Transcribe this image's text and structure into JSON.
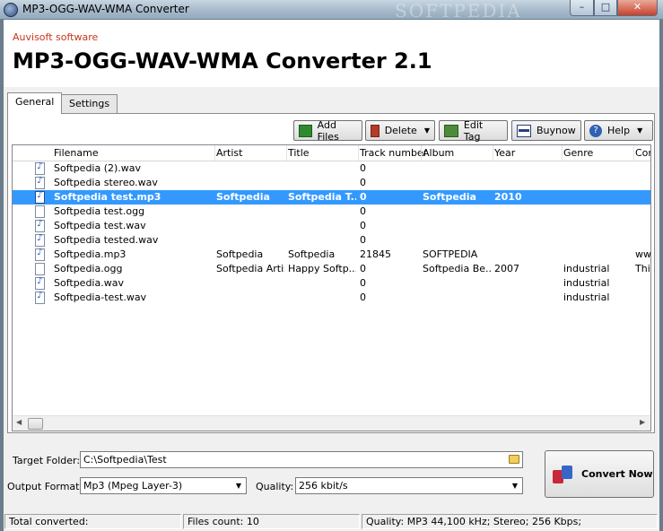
{
  "window": {
    "title": "MP3-OGG-WAV-WMA Converter",
    "watermark": "SOFTPEDIA",
    "minimize_glyph": "–",
    "maximize_glyph": "□",
    "close_glyph": "✕"
  },
  "header": {
    "vendor": "Auvisoft software",
    "product": "MP3-OGG-WAV-WMA Converter 2.1"
  },
  "tabs": [
    {
      "label": "General",
      "active": true
    },
    {
      "label": "Settings",
      "active": false
    }
  ],
  "toolbar": {
    "add_files": "Add Files",
    "delete": "Delete",
    "edit_tag": "Edit Tag",
    "buynow": "Buynow",
    "help": "Help",
    "dropdown_glyph": "▼",
    "help_glyph": "?"
  },
  "columns": [
    "Filename",
    "Artist",
    "Title",
    "Track number",
    "Album",
    "Year",
    "Genre",
    "Com"
  ],
  "rows": [
    {
      "filename": "Softpedia (2).wav",
      "artist": "",
      "title": "",
      "track": "0",
      "album": "",
      "year": "",
      "genre": "",
      "comment": "",
      "icon": "audio-file-icon",
      "selected": false
    },
    {
      "filename": "Softpedia stereo.wav",
      "artist": "",
      "title": "",
      "track": "0",
      "album": "",
      "year": "",
      "genre": "",
      "comment": "",
      "icon": "audio-file-icon",
      "selected": false
    },
    {
      "filename": "Softpedia test.mp3",
      "artist": "Softpedia",
      "title": "Softpedia T...",
      "track": "0",
      "album": "Softpedia",
      "year": "2010",
      "genre": "",
      "comment": "",
      "icon": "audio-file-icon",
      "selected": true
    },
    {
      "filename": "Softpedia test.ogg",
      "artist": "",
      "title": "",
      "track": "0",
      "album": "",
      "year": "",
      "genre": "",
      "comment": "",
      "icon": "blank-file-icon",
      "selected": false
    },
    {
      "filename": "Softpedia test.wav",
      "artist": "",
      "title": "",
      "track": "0",
      "album": "",
      "year": "",
      "genre": "",
      "comment": "",
      "icon": "audio-file-icon",
      "selected": false
    },
    {
      "filename": "Softpedia tested.wav",
      "artist": "",
      "title": "",
      "track": "0",
      "album": "",
      "year": "",
      "genre": "",
      "comment": "",
      "icon": "audio-file-icon",
      "selected": false
    },
    {
      "filename": "Softpedia.mp3",
      "artist": "Softpedia",
      "title": "Softpedia",
      "track": "21845",
      "album": "SOFTPEDIA",
      "year": "",
      "genre": "",
      "comment": "www",
      "icon": "audio-file-icon",
      "selected": false
    },
    {
      "filename": "Softpedia.ogg",
      "artist": "Softpedia Artist",
      "title": "Happy Softp...",
      "track": "0",
      "album": "Softpedia Be...",
      "year": "2007",
      "genre": "industrial",
      "comment": "This",
      "icon": "blank-file-icon",
      "selected": false
    },
    {
      "filename": "Softpedia.wav",
      "artist": "",
      "title": "",
      "track": "0",
      "album": "",
      "year": "",
      "genre": "industrial",
      "comment": "",
      "icon": "audio-file-icon",
      "selected": false
    },
    {
      "filename": "Softpedia-test.wav",
      "artist": "",
      "title": "",
      "track": "0",
      "album": "",
      "year": "",
      "genre": "industrial",
      "comment": "",
      "icon": "audio-file-icon",
      "selected": false
    }
  ],
  "form": {
    "target_folder_label": "Target Folder:",
    "target_folder_value": "C:\\Softpedia\\Test",
    "output_format_label": "Output Format:",
    "output_format_value": "Mp3 (Mpeg Layer-3)",
    "quality_label": "Quality:",
    "quality_value": "256 kbit/s",
    "convert_label": "Convert Now",
    "combo_glyph": "▼"
  },
  "scroll": {
    "left_glyph": "◀",
    "right_glyph": "▶"
  },
  "status": {
    "total_converted": "Total converted:",
    "files_count": "Files count: 10",
    "quality": "Quality: MP3 44,100 kHz; Stereo;  256 Kbps;"
  },
  "colors": {
    "selection": "#3399ff",
    "vendor": "#c6361b"
  }
}
